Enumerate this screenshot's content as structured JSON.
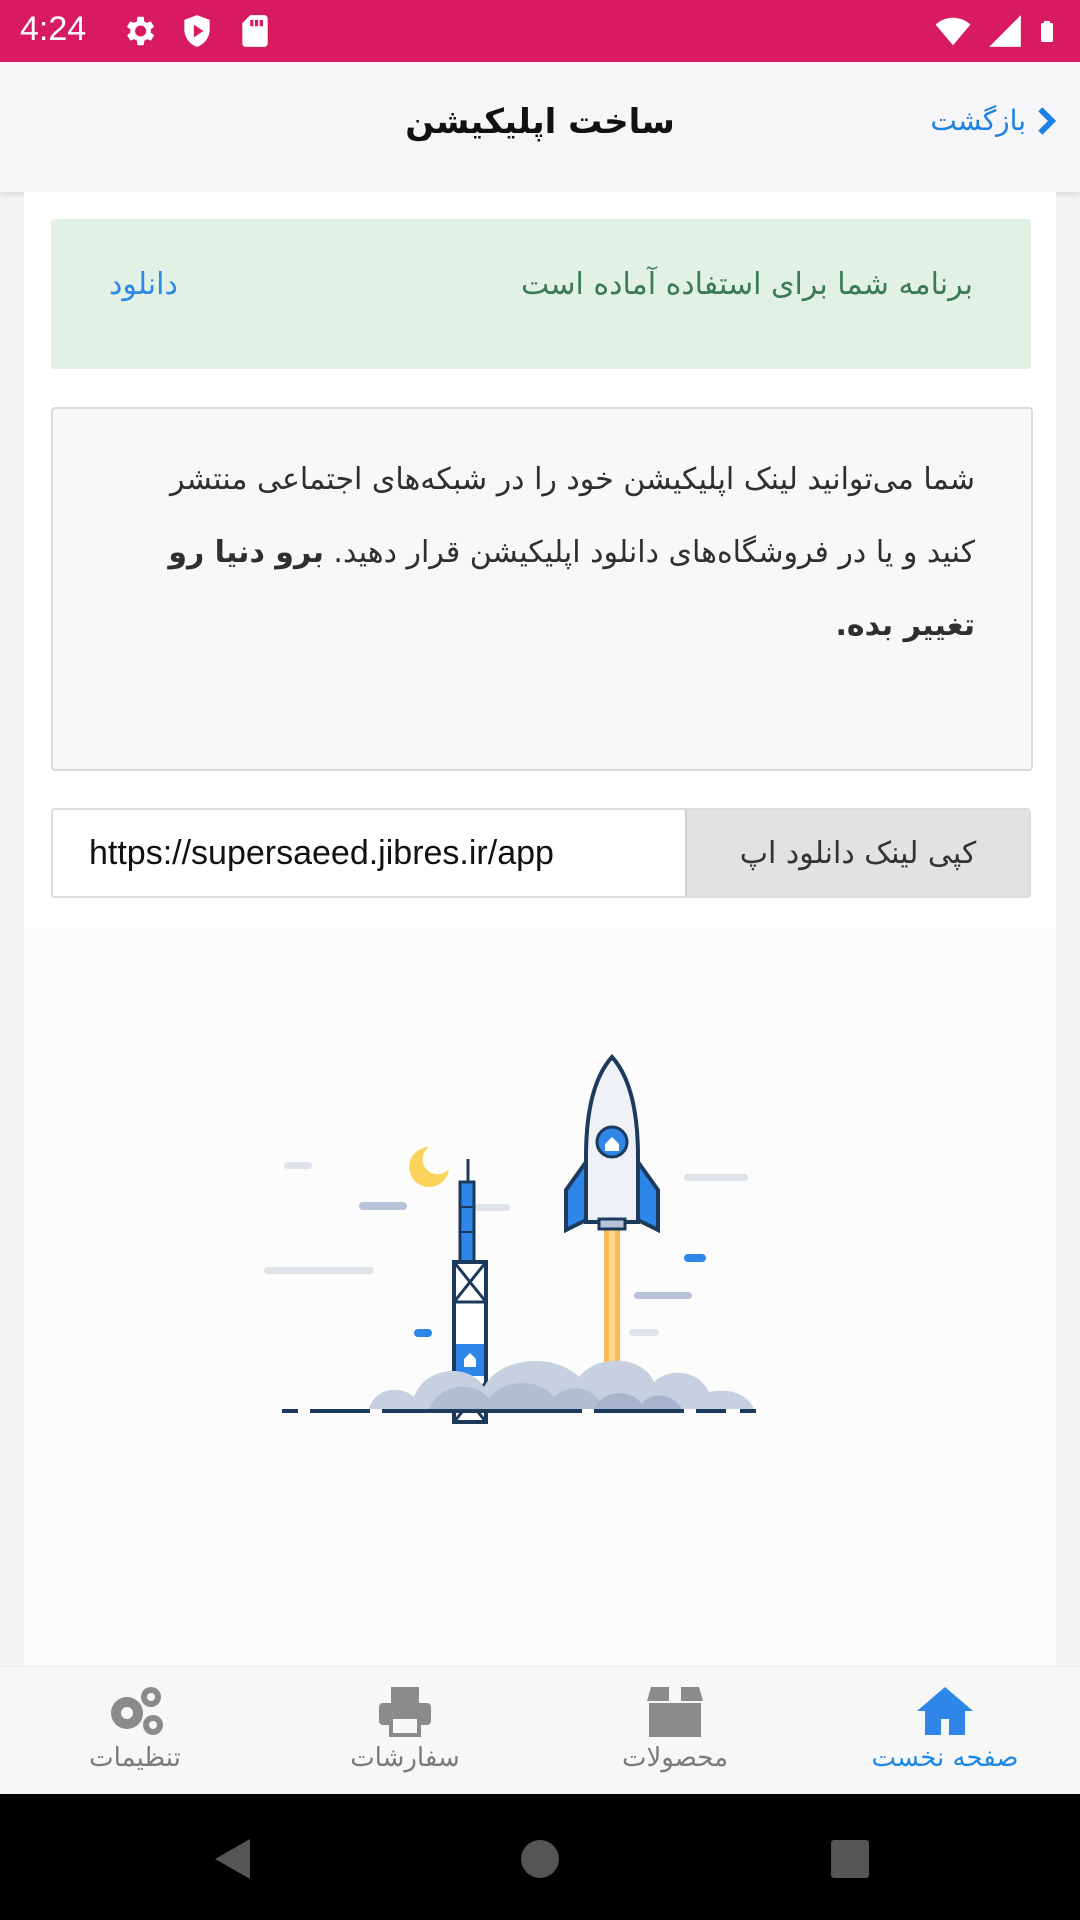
{
  "status_bar": {
    "time": "4:24",
    "icons": [
      "settings-icon",
      "shield-icon",
      "sd-card-icon",
      "wifi-icon",
      "signal-icon",
      "battery-icon"
    ],
    "color": "#d81b60"
  },
  "header": {
    "title": "ساخت اپلیکیشن",
    "back_label": "بازگشت"
  },
  "alert": {
    "message": "برنامه شما برای استفاده آماده است",
    "download_label": "دانلود",
    "background": "#e1f1e5"
  },
  "info": {
    "text_normal": "شما می‌توانید لینک اپلیکیشن خود را در شبکه‌های اجتماعی منتشر کنید و یا در فروشگاه‌های دانلود اپلیکیشن قرار دهید. ",
    "text_bold": "برو دنیا رو تغییر بده."
  },
  "link": {
    "url": "https://supersaeed.jibres.ir/app",
    "copy_label": "کپی لینک دانلود اپ"
  },
  "bottom_nav": {
    "items": [
      {
        "label": "صفحه نخست",
        "icon": "home-icon",
        "active": true
      },
      {
        "label": "محصولات",
        "icon": "box-icon",
        "active": false
      },
      {
        "label": "سفارشات",
        "icon": "printer-icon",
        "active": false
      },
      {
        "label": "تنظیمات",
        "icon": "gears-icon",
        "active": false
      }
    ],
    "active_color": "#1e88e5"
  },
  "system_nav": {
    "buttons": [
      "back-triangle-icon",
      "home-circle-icon",
      "recents-square-icon"
    ]
  }
}
